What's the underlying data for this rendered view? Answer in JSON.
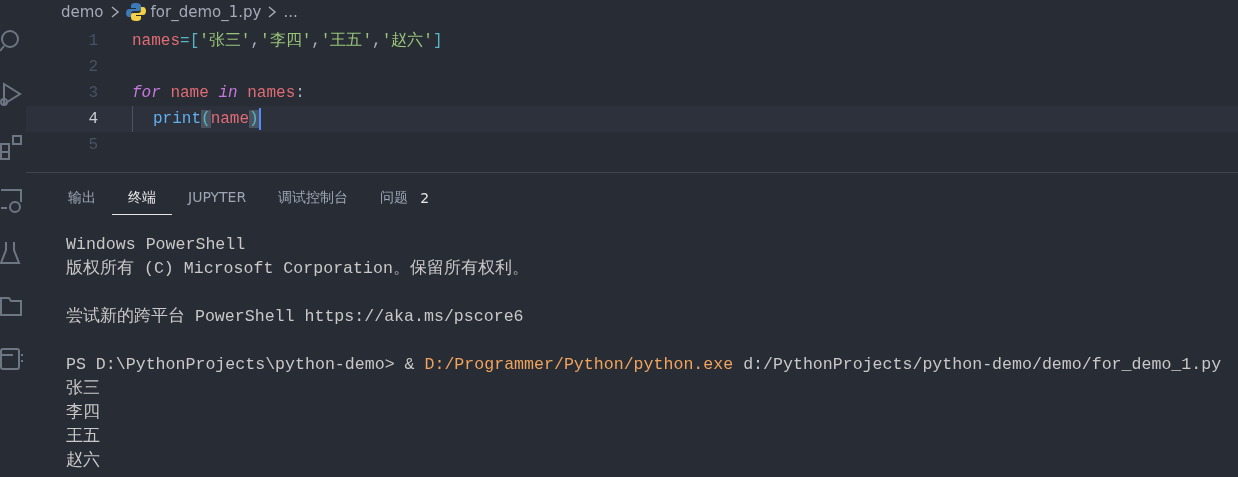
{
  "breadcrumb": {
    "folder": "demo",
    "file": "for_demo_1.py",
    "more": "..."
  },
  "editor": {
    "lines": [
      {
        "number": "1",
        "current": false,
        "indented": false,
        "cursor": false,
        "tokens": [
          {
            "text": "names",
            "kind": "variable"
          },
          {
            "text": "=",
            "kind": "operator"
          },
          {
            "text": "[",
            "kind": "bracket"
          },
          {
            "text": "'张三'",
            "kind": "string"
          },
          {
            "text": ",",
            "kind": "punct"
          },
          {
            "text": "'李四'",
            "kind": "string"
          },
          {
            "text": ",",
            "kind": "punct"
          },
          {
            "text": "'王五'",
            "kind": "string"
          },
          {
            "text": ",",
            "kind": "punct"
          },
          {
            "text": "'赵六'",
            "kind": "string"
          },
          {
            "text": "]",
            "kind": "bracket"
          }
        ]
      },
      {
        "number": "2",
        "current": false,
        "indented": false,
        "cursor": false
      },
      {
        "number": "3",
        "current": false,
        "indented": false,
        "cursor": false,
        "tokens": [
          {
            "text": "for",
            "kind": "keyword"
          },
          {
            "text": " name",
            "kind": "variable"
          },
          {
            "text": " in",
            "kind": "keyword"
          },
          {
            "text": " names",
            "kind": "variable"
          },
          {
            "text": ":",
            "kind": "punct"
          }
        ]
      },
      {
        "number": "4",
        "current": true,
        "indented": true,
        "cursor": true,
        "tokens": [
          {
            "text": "print",
            "kind": "function"
          },
          {
            "text": "(",
            "kind": "paren",
            "matched": true
          },
          {
            "text": "name",
            "kind": "variable"
          },
          {
            "text": ")",
            "kind": "paren",
            "matched": true
          }
        ]
      },
      {
        "number": "5",
        "current": false,
        "indented": false,
        "cursor": false
      }
    ]
  },
  "panel": {
    "tabs": [
      {
        "label": "输出",
        "selected": false
      },
      {
        "label": "终端",
        "selected": true
      },
      {
        "label": "JUPYTER",
        "selected": false
      },
      {
        "label": "调试控制台",
        "selected": false
      },
      {
        "label": "问题",
        "selected": false,
        "count": "2"
      }
    ],
    "terminal": [
      {
        "gap_before": false,
        "segments": [
          {
            "text": "Windows PowerShell",
            "kind": "plain"
          }
        ]
      },
      {
        "gap_before": false,
        "segments": [
          {
            "text": "版权所有 (C) Microsoft Corporation。保留所有权利。",
            "kind": "plain"
          }
        ]
      },
      {
        "gap_before": true,
        "segments": [
          {
            "text": "尝试新的跨平台 PowerShell https://aka.ms/pscore6",
            "kind": "plain"
          }
        ]
      },
      {
        "gap_before": true,
        "segments": [
          {
            "text": "PS D:\\PythonProjects\\python-demo> & ",
            "kind": "plain"
          },
          {
            "text": "D:/Programmer/Python/python.exe",
            "kind": "command"
          },
          {
            "text": " d:/PythonProjects/python-demo/demo/for_demo_1.py",
            "kind": "plain"
          }
        ]
      },
      {
        "gap_before": false,
        "segments": [
          {
            "text": "张三",
            "kind": "plain"
          }
        ]
      },
      {
        "gap_before": false,
        "segments": [
          {
            "text": "李四",
            "kind": "plain"
          }
        ]
      },
      {
        "gap_before": false,
        "segments": [
          {
            "text": "王五",
            "kind": "plain"
          }
        ]
      },
      {
        "gap_before": false,
        "segments": [
          {
            "text": "赵六",
            "kind": "plain"
          }
        ]
      }
    ]
  }
}
